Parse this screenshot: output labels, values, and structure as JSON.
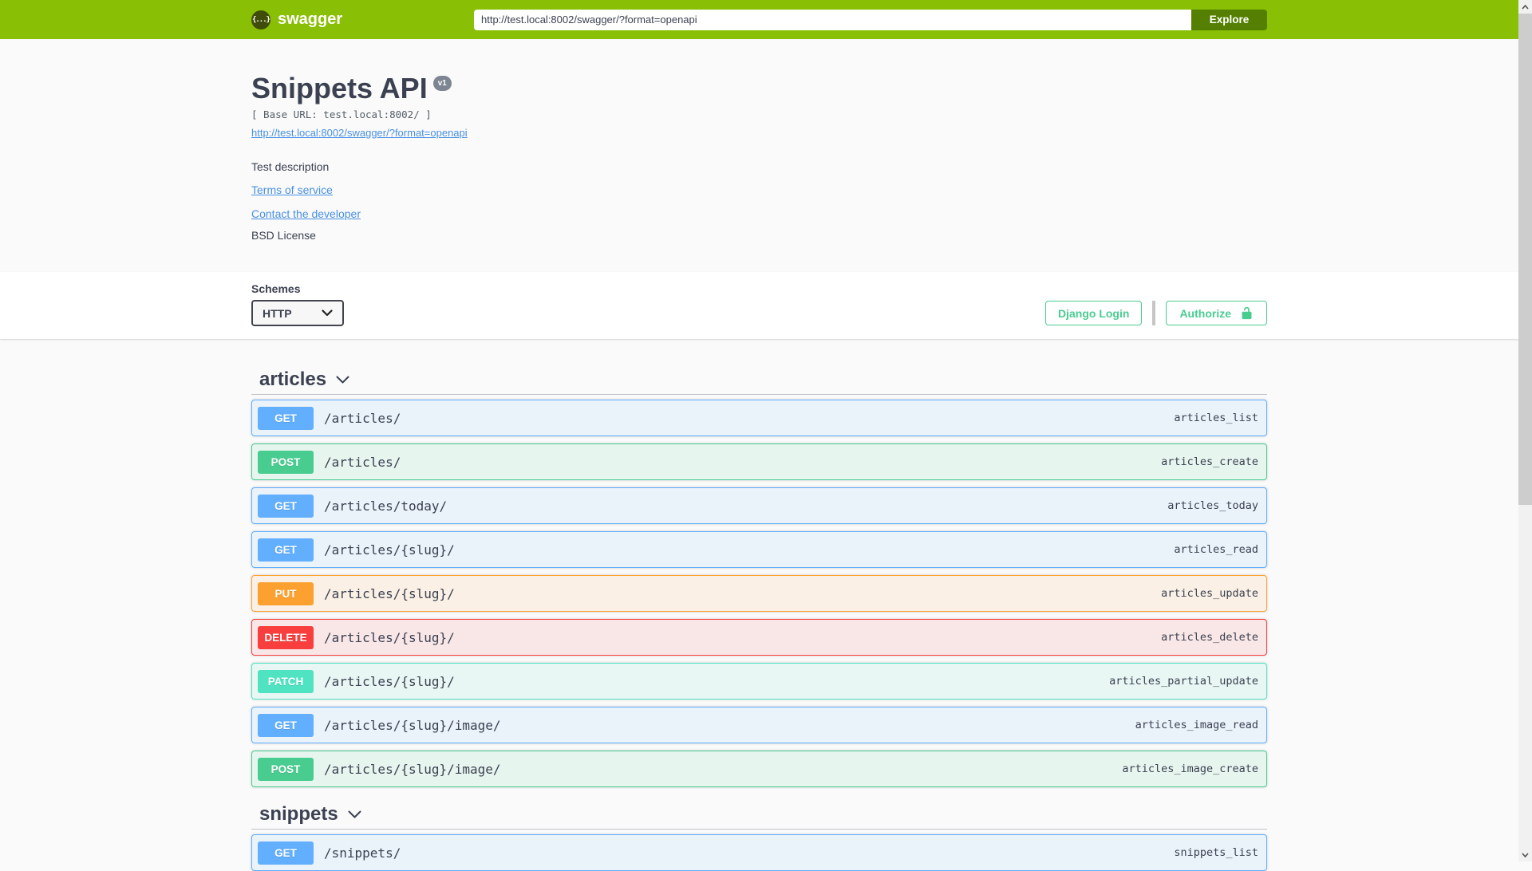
{
  "topbar": {
    "logo_text": "swagger",
    "logo_glyph": "{...}",
    "url_value": "http://test.local:8002/swagger/?format=openapi",
    "explore_label": "Explore"
  },
  "info": {
    "title": "Snippets API",
    "version_badge": "v1",
    "base_url": "[ Base URL: test.local:8002/ ]",
    "spec_link": "http://test.local:8002/swagger/?format=openapi",
    "description": "Test description",
    "terms_link": "Terms of service",
    "contact_link": "Contact the developer",
    "license": "BSD License"
  },
  "scheme_bar": {
    "schemes_label": "Schemes",
    "selected_scheme": "HTTP",
    "django_login_label": "Django Login",
    "authorize_label": "Authorize"
  },
  "colors": {
    "topbar_green": "#89bf04",
    "explore_button_green": "#547f00",
    "auth_green": "#49cc90",
    "link_blue": "#4990e2",
    "text": "#3b4151",
    "method_get": "#61affe",
    "method_post": "#49cc90",
    "method_put": "#fca130",
    "method_delete": "#f93e3e",
    "method_patch": "#50e3c2",
    "version_badge_bg": "#7d8492",
    "section_bg": "#fafafa"
  },
  "sections": [
    {
      "tag": "articles",
      "operations": [
        {
          "method": "GET",
          "path": "/articles/",
          "operation_id": "articles_list"
        },
        {
          "method": "POST",
          "path": "/articles/",
          "operation_id": "articles_create"
        },
        {
          "method": "GET",
          "path": "/articles/today/",
          "operation_id": "articles_today"
        },
        {
          "method": "GET",
          "path": "/articles/{slug}/",
          "operation_id": "articles_read"
        },
        {
          "method": "PUT",
          "path": "/articles/{slug}/",
          "operation_id": "articles_update"
        },
        {
          "method": "DELETE",
          "path": "/articles/{slug}/",
          "operation_id": "articles_delete"
        },
        {
          "method": "PATCH",
          "path": "/articles/{slug}/",
          "operation_id": "articles_partial_update"
        },
        {
          "method": "GET",
          "path": "/articles/{slug}/image/",
          "operation_id": "articles_image_read"
        },
        {
          "method": "POST",
          "path": "/articles/{slug}/image/",
          "operation_id": "articles_image_create"
        }
      ]
    },
    {
      "tag": "snippets",
      "operations": [
        {
          "method": "GET",
          "path": "/snippets/",
          "operation_id": "snippets_list"
        }
      ]
    }
  ]
}
